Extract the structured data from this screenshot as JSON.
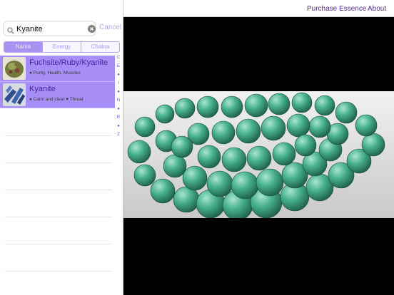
{
  "search": {
    "query": "Kyanite",
    "cancel_label": "Cancel"
  },
  "segments": [
    "Name",
    "Energy",
    "Chakra"
  ],
  "active_segment": "Name",
  "results": [
    {
      "title": "Fuchsite/Ruby/Kyanite",
      "subtitle": "● Purity, Health, Muscles"
    },
    {
      "title": "Kyanite",
      "subtitle": "● Calm and clear ♥ Throat"
    }
  ],
  "index_letters": [
    "C",
    "E",
    "●",
    "I",
    "●",
    "N",
    "●",
    "R",
    "●",
    "Z"
  ],
  "topbar": {
    "purchase_label": "Purchase Essence",
    "about_label": "About"
  },
  "colors": {
    "accent": "#a68ef6",
    "link": "#5b2a8f",
    "bead": "#3fae8c"
  }
}
